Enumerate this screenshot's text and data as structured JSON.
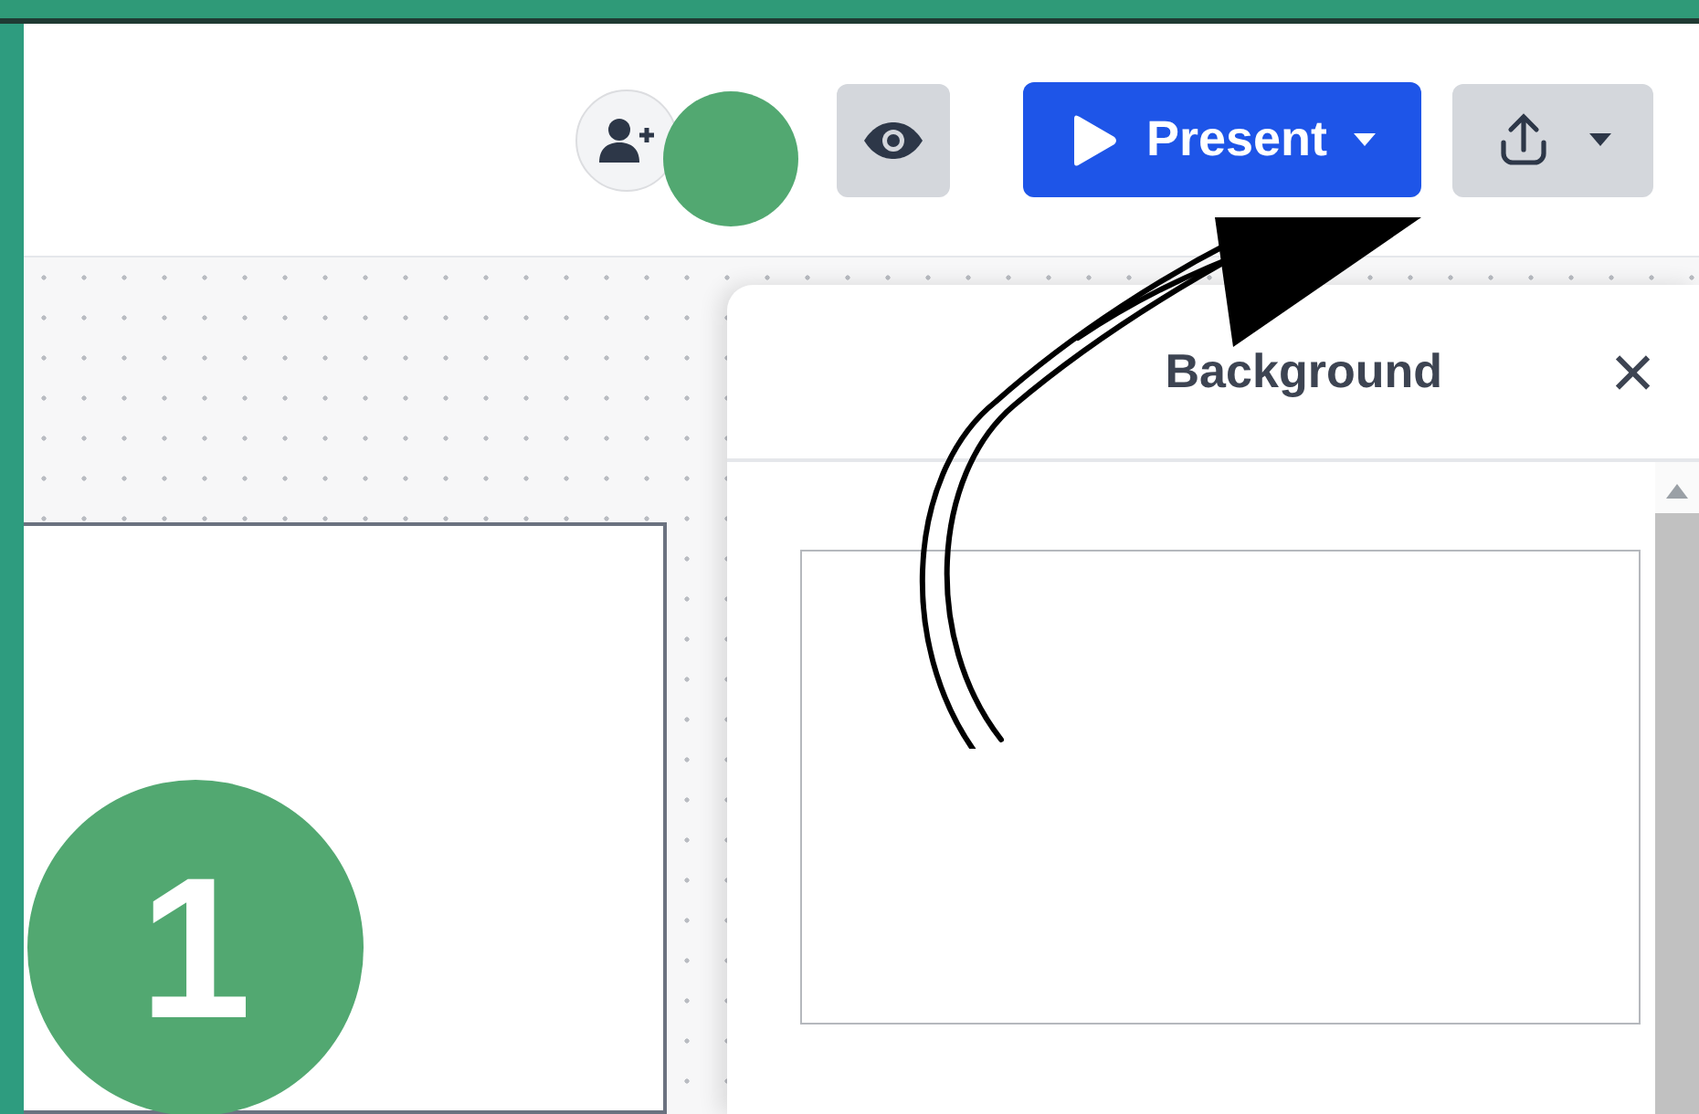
{
  "toolbar": {
    "present_button": {
      "label": "Present"
    }
  },
  "panel": {
    "title": "Background",
    "close_icon": "×"
  },
  "annotation": {
    "step": "1"
  }
}
